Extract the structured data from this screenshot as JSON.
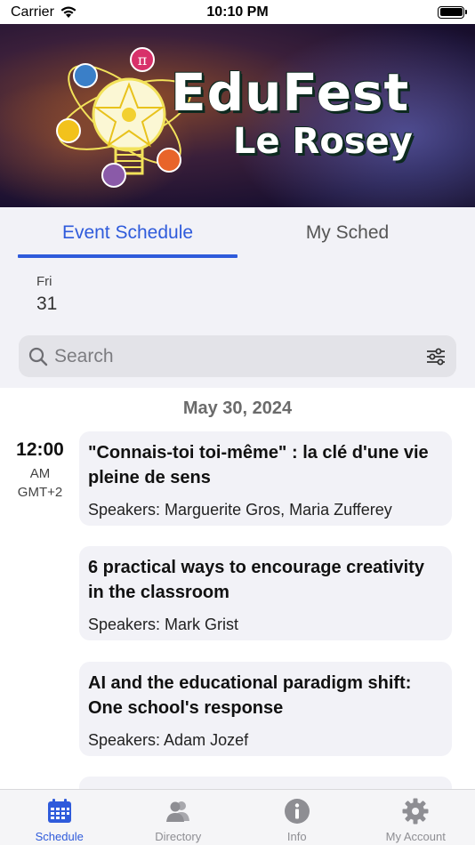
{
  "status_bar": {
    "carrier": "Carrier",
    "time": "10:10 PM"
  },
  "banner": {
    "title": "EduFest",
    "subtitle": "Le Rosey"
  },
  "tabs": [
    {
      "label": "Event Schedule",
      "active": true
    },
    {
      "label": "My Sched",
      "active": false
    }
  ],
  "date_picker": {
    "day_of_week": "Fri",
    "day": "31"
  },
  "search": {
    "placeholder": "Search",
    "value": ""
  },
  "schedule": {
    "date_header": "May 30, 2024",
    "time": {
      "time": "12:00",
      "ampm": "AM",
      "timezone": "GMT+2"
    },
    "sessions": [
      {
        "title": "\"Connais-toi toi-même\" : la clé d'une vie pleine de sens",
        "speakers": "Speakers: Marguerite Gros, Maria Zufferey"
      },
      {
        "title": "6 practical ways to encourage creativity in the classroom",
        "speakers": "Speakers: Mark Grist"
      },
      {
        "title": "AI and the educational paradigm shift: One school's response",
        "speakers": "Speakers: Adam Jozef"
      }
    ]
  },
  "bottom_nav": [
    {
      "label": "Schedule",
      "icon": "calendar-icon",
      "active": true
    },
    {
      "label": "Directory",
      "icon": "people-icon",
      "active": false
    },
    {
      "label": "Info",
      "icon": "info-icon",
      "active": false
    },
    {
      "label": "My Account",
      "icon": "gear-icon",
      "active": false
    }
  ],
  "colors": {
    "accent": "#2f5bdb",
    "inactive": "#8e8e93"
  }
}
